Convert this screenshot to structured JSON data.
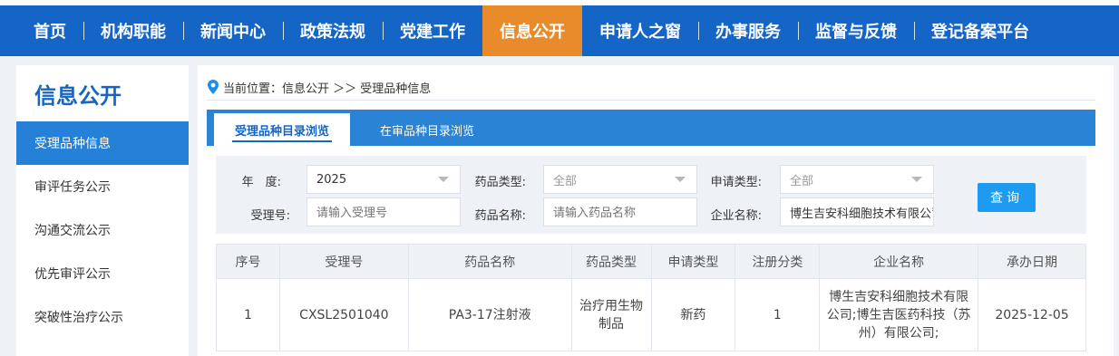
{
  "nav": [
    "首页",
    "机构职能",
    "新闻中心",
    "政策法规",
    "党建工作",
    "信息公开",
    "申请人之窗",
    "办事服务",
    "监督与反馈",
    "登记备案平台"
  ],
  "nav_active_index": 5,
  "sidebar": {
    "title": "信息公开",
    "items": [
      "受理品种信息",
      "审评任务公示",
      "沟通交流公示",
      "优先审评公示",
      "突破性治疗公示"
    ]
  },
  "breadcrumb": "当前位置：信息公开 ＞＞ 受理品种信息",
  "tabs": [
    "受理品种目录浏览",
    "在审品种目录浏览"
  ],
  "filter": {
    "year_label": "年　度:",
    "year_value": "2025",
    "drug_type_label": "药品类型:",
    "drug_type_value": "全部",
    "apply_type_label": "申请类型:",
    "apply_type_value": "全部",
    "accept_no_label": "受理号:",
    "accept_no_placeholder": "请输入受理号",
    "drug_name_label": "药品名称:",
    "drug_name_placeholder": "请输入药品名称",
    "company_label": "企业名称:",
    "company_value": "博生吉安科细胞技术有限公司",
    "query_button": "查询"
  },
  "table": {
    "headers": [
      "序号",
      "受理号",
      "药品名称",
      "药品类型",
      "申请类型",
      "注册分类",
      "企业名称",
      "承办日期"
    ],
    "rows": [
      [
        "1",
        "CXSL2501040",
        "PA3-17注射液",
        "治疗用生物制品",
        "新药",
        "1",
        "博生吉安科细胞技术有限公司;博生吉医药科技（苏州）有限公司;",
        "2025-12-05"
      ]
    ]
  },
  "colors": {
    "nav_blue": "#1565c7",
    "nav_active": "#e98b2a",
    "sidebar_active": "#2580d8",
    "query_button": "#1e9bf0"
  }
}
